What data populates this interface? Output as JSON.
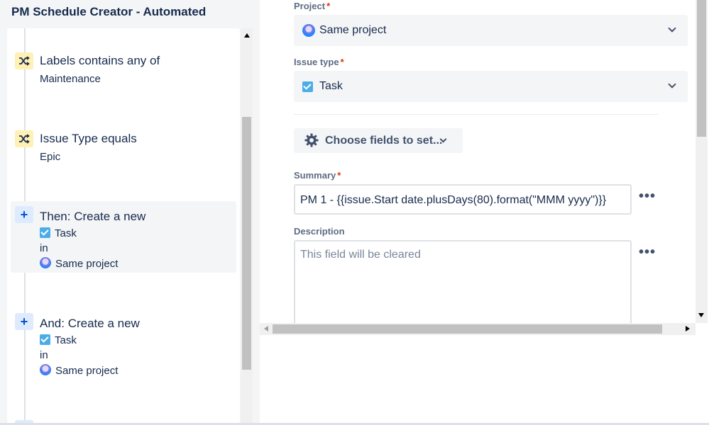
{
  "app": {
    "title": "PM Schedule Creator - Automated"
  },
  "rule": {
    "items": [
      {
        "kind": "condition",
        "icon": "shuffle-icon",
        "title": "Labels contains any of",
        "subtitle": "Maintenance"
      },
      {
        "kind": "condition",
        "icon": "shuffle-icon",
        "title": "Issue Type equals",
        "subtitle": "Epic"
      },
      {
        "kind": "action",
        "icon": "plus-icon",
        "plus": "+",
        "title": "Then: Create a new",
        "issue_type": "Task",
        "in_label": "in",
        "project": "Same project",
        "selected": true
      },
      {
        "kind": "action",
        "icon": "plus-icon",
        "plus": "+",
        "title": "And: Create a new",
        "issue_type": "Task",
        "in_label": "in",
        "project": "Same project",
        "selected": false
      }
    ]
  },
  "form": {
    "project": {
      "label": "Project",
      "required": "*",
      "value": "Same project",
      "icon": "project-avatar-icon"
    },
    "issue_type": {
      "label": "Issue type",
      "required": "*",
      "value": "Task",
      "icon": "task-checkbox-icon"
    },
    "choose_fields": {
      "label": "Choose fields to set...",
      "icon": "gear-icon"
    },
    "summary": {
      "label": "Summary",
      "required": "*",
      "value": "PM 1 - {{issue.Start date.plusDays(80).format(\"MMM yyyy\")}}"
    },
    "description": {
      "label": "Description",
      "placeholder": "This field will be cleared"
    },
    "more": "•••"
  },
  "colors": {
    "accent": "#0052cc",
    "condition_bg": "#fff0b3",
    "action_bg": "#deebff",
    "task_blue": "#4bade8",
    "required": "#de350b"
  }
}
